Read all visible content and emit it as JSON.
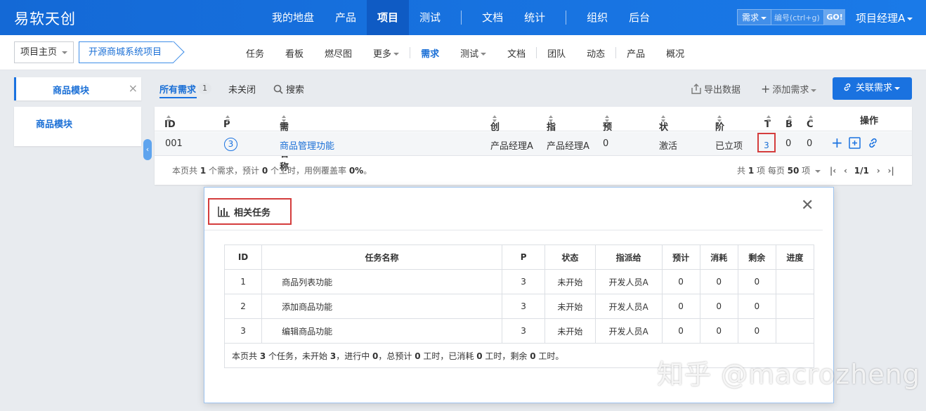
{
  "brand": "易软天创",
  "topnav": {
    "items": [
      "我的地盘",
      "产品",
      "项目",
      "测试",
      "文档",
      "统计",
      "组织",
      "后台"
    ],
    "active": "项目"
  },
  "search": {
    "type_label": "需求",
    "placeholder": "编号(ctrl+g)",
    "go_label": "GO!"
  },
  "user": {
    "name": "项目经理A"
  },
  "breadcrumb": {
    "home": "项目主页",
    "project": "开源商城系统项目"
  },
  "subnav": {
    "items": [
      "任务",
      "看板",
      "燃尽图",
      "更多",
      "需求",
      "测试",
      "文档",
      "团队",
      "动态",
      "产品",
      "概况"
    ],
    "active": "需求"
  },
  "sidebar": {
    "tab_title": "商品模块",
    "close": "×",
    "module_item": "商品模块"
  },
  "filter": {
    "all_label": "所有需求",
    "all_count": "1",
    "unclosed_label": "未关闭",
    "search_label": "搜索",
    "export_label": "导出数据",
    "add_label": "添加需求",
    "link_label": "关联需求"
  },
  "story_table": {
    "headers": {
      "id": "ID",
      "pri": "P",
      "name": "需求名称",
      "creator": "创建",
      "assigned": "指派",
      "estimate": "预计",
      "status": "状态",
      "stage": "阶段",
      "t": "T",
      "b": "B",
      "c": "C",
      "actions": "操作"
    },
    "rows": [
      {
        "id": "001",
        "pri": "3",
        "name": "商品管理功能",
        "creator": "产品经理A",
        "assigned": "产品经理A",
        "estimate": "0",
        "status": "激活",
        "stage": "已立项",
        "t": "3",
        "b": "0",
        "c": "0"
      }
    ],
    "footer": {
      "s1": "本页共 ",
      "count": "1",
      "s2": " 个需求，预计 ",
      "hours": "0",
      "s3": " 个工时，用例覆盖率 ",
      "coverage": "0%",
      "s4": "。"
    },
    "pager": {
      "p1": "共 ",
      "total": "1",
      "p2": " 项  每页 ",
      "per_page": "50",
      "p3": " 项",
      "page": "1/1"
    }
  },
  "modal": {
    "title": "相关任务",
    "close": "✕",
    "headers": {
      "id": "ID",
      "name": "任务名称",
      "pri": "P",
      "status": "状态",
      "assigned": "指派给",
      "estimate": "预计",
      "consumed": "消耗",
      "left": "剩余",
      "progress": "进度"
    },
    "rows": [
      {
        "id": "1",
        "name": "商品列表功能",
        "pri": "3",
        "status": "未开始",
        "assigned": "开发人员A",
        "estimate": "0",
        "consumed": "0",
        "left": "0",
        "progress": ""
      },
      {
        "id": "2",
        "name": "添加商品功能",
        "pri": "3",
        "status": "未开始",
        "assigned": "开发人员A",
        "estimate": "0",
        "consumed": "0",
        "left": "0",
        "progress": ""
      },
      {
        "id": "3",
        "name": "编辑商品功能",
        "pri": "3",
        "status": "未开始",
        "assigned": "开发人员A",
        "estimate": "0",
        "consumed": "0",
        "left": "0",
        "progress": ""
      }
    ],
    "summary": {
      "s1": "本页共 ",
      "count": "3",
      "s2": " 个任务，未开始 ",
      "wait": "3",
      "s3": "，进行中 ",
      "doing": "0",
      "s4": "，总预计 ",
      "estimate": "0",
      "s5": " 工时，已消耗 ",
      "consumed": "0",
      "s6": " 工时，剩余 ",
      "left": "0",
      "s7": " 工时。"
    }
  },
  "watermark": "知乎 @macrozheng",
  "colors": {
    "primary": "#1a72e0",
    "highlight": "#d43d3d"
  }
}
